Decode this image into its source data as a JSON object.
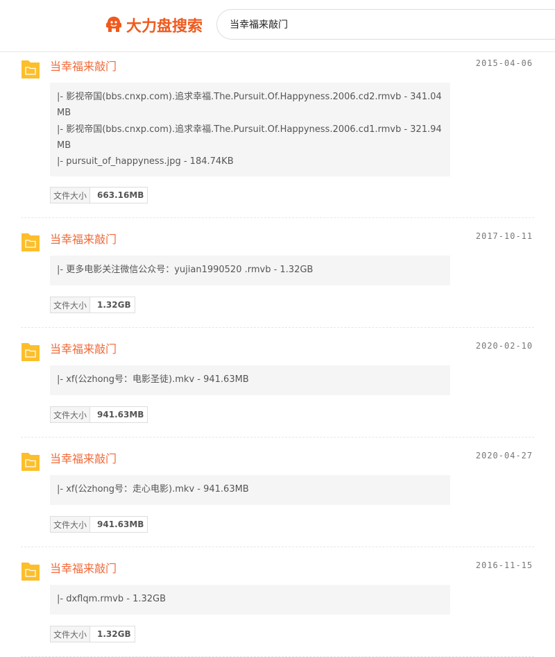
{
  "header": {
    "logo_text": "大力盘搜索",
    "search_value": "当幸福来敲门",
    "brand_color": "#f05a1e"
  },
  "results": [
    {
      "title": "当幸福来敲门",
      "date": "2015-04-06",
      "files": [
        "|- 影视帝国(bbs.cnxp.com).追求幸福.The.Pursuit.Of.Happyness.2006.cd2.rmvb - 341.04MB",
        "|- 影视帝国(bbs.cnxp.com).追求幸福.The.Pursuit.Of.Happyness.2006.cd1.rmvb - 321.94MB",
        "|- pursuit_of_happyness.jpg - 184.74KB"
      ],
      "size_label": "文件大小",
      "size_value": "663.16MB"
    },
    {
      "title": "当幸福来敲门",
      "date": "2017-10-11",
      "files": [
        "|- 更多电影关注微信公众号：yujian1990520 .rmvb - 1.32GB"
      ],
      "size_label": "文件大小",
      "size_value": "1.32GB"
    },
    {
      "title": "当幸福来敲门",
      "date": "2020-02-10",
      "files": [
        "|- xf(公zhong号：电影圣徒).mkv - 941.63MB"
      ],
      "size_label": "文件大小",
      "size_value": "941.63MB"
    },
    {
      "title": "当幸福来敲门",
      "date": "2020-04-27",
      "files": [
        "|- xf(公zhong号：走心电影).mkv - 941.63MB"
      ],
      "size_label": "文件大小",
      "size_value": "941.63MB"
    },
    {
      "title": "当幸福来敲门",
      "date": "2016-11-15",
      "files": [
        "|- dxflqm.rmvb - 1.32GB"
      ],
      "size_label": "文件大小",
      "size_value": "1.32GB"
    }
  ]
}
